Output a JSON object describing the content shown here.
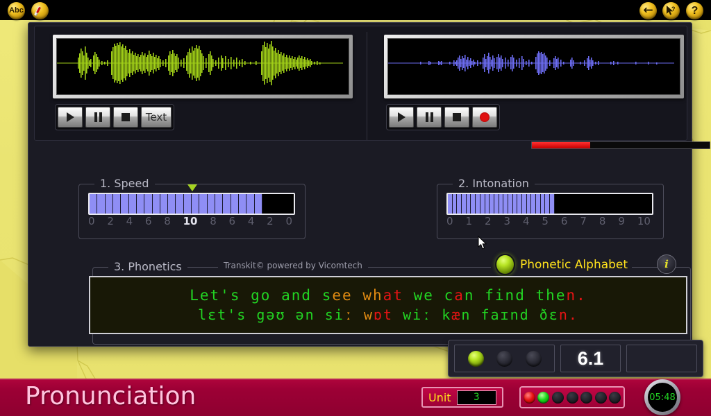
{
  "topbar": {
    "left_buttons": [
      {
        "name": "abc-button",
        "label": "Abc",
        "icon": "abc-icon"
      },
      {
        "name": "pen-button",
        "label": "",
        "icon": "pen-icon"
      }
    ],
    "right_buttons": [
      {
        "name": "back-button",
        "label": "←",
        "icon": "arrow-left-icon"
      },
      {
        "name": "help-cursor-button",
        "label": "",
        "icon": "cursor-question-icon"
      },
      {
        "name": "help-button",
        "label": "?",
        "icon": "question-mark-icon"
      }
    ]
  },
  "model_audio": {
    "panel_name": "model-waveform",
    "waveform_color": "#9 acd",
    "color": "#a2d118",
    "transport": [
      {
        "name": "play-button",
        "icon": "play-icon",
        "label": ""
      },
      {
        "name": "pause-button",
        "icon": "pause-icon",
        "label": ""
      },
      {
        "name": "stop-button",
        "icon": "stop-icon",
        "label": ""
      },
      {
        "name": "text-button",
        "icon": "text-icon",
        "label": "Text"
      }
    ]
  },
  "user_audio": {
    "panel_name": "user-waveform",
    "color": "#6c6cf0",
    "transport": [
      {
        "name": "play-button",
        "icon": "play-icon",
        "label": ""
      },
      {
        "name": "pause-button",
        "icon": "pause-icon",
        "label": ""
      },
      {
        "name": "stop-button",
        "icon": "stop-icon",
        "label": ""
      },
      {
        "name": "record-button",
        "icon": "record-icon",
        "label": ""
      }
    ],
    "level_percent": 33,
    "level_color": "#e01010"
  },
  "speed": {
    "title": "1. Speed",
    "segments_total": 26,
    "segments_filled": 22,
    "marker_position_percent": 51,
    "scale": [
      "0",
      "2",
      "4",
      "6",
      "8",
      "10",
      "8",
      "6",
      "4",
      "2",
      "0"
    ],
    "scale_highlight_index": 5,
    "bar_color": "#8f8ef5"
  },
  "intonation": {
    "title": "2. Intonation",
    "segments_total": 44,
    "segments_filled": 23,
    "scale": [
      "0",
      "1",
      "2",
      "3",
      "4",
      "5",
      "6",
      "7",
      "8",
      "9",
      "10"
    ],
    "scale_highlight_index": -1,
    "bar_color": "#8f8ef5"
  },
  "phonetics": {
    "title": "3. Phonetics",
    "credit": "Transkit© powered by Vicomtech",
    "alphabet_toggle_label": "Phonetic Alphabet",
    "alphabet_toggle_state": "on",
    "info_label": "i",
    "orthographic_line": [
      {
        "text": "L",
        "color": "green"
      },
      {
        "text": "e",
        "color": "green"
      },
      {
        "text": "t",
        "color": "green"
      },
      {
        "text": "'",
        "color": "green"
      },
      {
        "text": "s",
        "color": "green"
      },
      {
        "text": " ",
        "color": "green"
      },
      {
        "text": "g",
        "color": "green"
      },
      {
        "text": "o",
        "color": "green"
      },
      {
        "text": " ",
        "color": "green"
      },
      {
        "text": "a",
        "color": "green"
      },
      {
        "text": "n",
        "color": "green"
      },
      {
        "text": "d",
        "color": "green"
      },
      {
        "text": " ",
        "color": "green"
      },
      {
        "text": "s",
        "color": "green"
      },
      {
        "text": "e",
        "color": "orange"
      },
      {
        "text": "e",
        "color": "orange"
      },
      {
        "text": " ",
        "color": "green"
      },
      {
        "text": "w",
        "color": "orange"
      },
      {
        "text": "h",
        "color": "orange"
      },
      {
        "text": "a",
        "color": "red"
      },
      {
        "text": "t",
        "color": "red"
      },
      {
        "text": " ",
        "color": "green"
      },
      {
        "text": "w",
        "color": "green"
      },
      {
        "text": "e",
        "color": "green"
      },
      {
        "text": " ",
        "color": "green"
      },
      {
        "text": "c",
        "color": "green"
      },
      {
        "text": "a",
        "color": "red"
      },
      {
        "text": "n",
        "color": "green"
      },
      {
        "text": " ",
        "color": "green"
      },
      {
        "text": "f",
        "color": "green"
      },
      {
        "text": "i",
        "color": "green"
      },
      {
        "text": "n",
        "color": "green"
      },
      {
        "text": "d",
        "color": "green"
      },
      {
        "text": " ",
        "color": "green"
      },
      {
        "text": "t",
        "color": "green"
      },
      {
        "text": "h",
        "color": "green"
      },
      {
        "text": "e",
        "color": "green"
      },
      {
        "text": "n",
        "color": "red"
      },
      {
        "text": ".",
        "color": "red"
      }
    ],
    "ipa_line": [
      {
        "text": "l",
        "color": "green"
      },
      {
        "text": "ɛ",
        "color": "green"
      },
      {
        "text": "t",
        "color": "green"
      },
      {
        "text": "'",
        "color": "green"
      },
      {
        "text": "s",
        "color": "green"
      },
      {
        "text": " ",
        "color": "green"
      },
      {
        "text": "g",
        "color": "green"
      },
      {
        "text": "ə",
        "color": "green"
      },
      {
        "text": "ʊ",
        "color": "green"
      },
      {
        "text": " ",
        "color": "green"
      },
      {
        "text": "ə",
        "color": "green"
      },
      {
        "text": "n",
        "color": "green"
      },
      {
        "text": " ",
        "color": "green"
      },
      {
        "text": "s",
        "color": "green"
      },
      {
        "text": "i",
        "color": "green"
      },
      {
        "text": "ː",
        "color": "orange"
      },
      {
        "text": " ",
        "color": "green"
      },
      {
        "text": "w",
        "color": "orange"
      },
      {
        "text": "ɒ",
        "color": "red"
      },
      {
        "text": "t",
        "color": "red"
      },
      {
        "text": " ",
        "color": "green"
      },
      {
        "text": "w",
        "color": "green"
      },
      {
        "text": "i",
        "color": "green"
      },
      {
        "text": "ː",
        "color": "green"
      },
      {
        "text": " ",
        "color": "green"
      },
      {
        "text": "k",
        "color": "green"
      },
      {
        "text": "æ",
        "color": "red"
      },
      {
        "text": "n",
        "color": "green"
      },
      {
        "text": " ",
        "color": "green"
      },
      {
        "text": "f",
        "color": "green"
      },
      {
        "text": "a",
        "color": "green"
      },
      {
        "text": "ɪ",
        "color": "green"
      },
      {
        "text": "n",
        "color": "green"
      },
      {
        "text": "d",
        "color": "green"
      },
      {
        "text": " ",
        "color": "green"
      },
      {
        "text": "ð",
        "color": "green"
      },
      {
        "text": "ɛ",
        "color": "green"
      },
      {
        "text": "n",
        "color": "red"
      },
      {
        "text": ".",
        "color": "red"
      }
    ]
  },
  "score": {
    "leds": [
      "on",
      "off",
      "off"
    ],
    "value": "6.1",
    "extra_box": ""
  },
  "footer": {
    "title": "Pronunciation",
    "unit_label": "Unit",
    "unit_value": "3",
    "progress_leds": [
      "red",
      "green",
      "off",
      "off",
      "off",
      "off",
      "off"
    ],
    "timer": "05:48"
  }
}
